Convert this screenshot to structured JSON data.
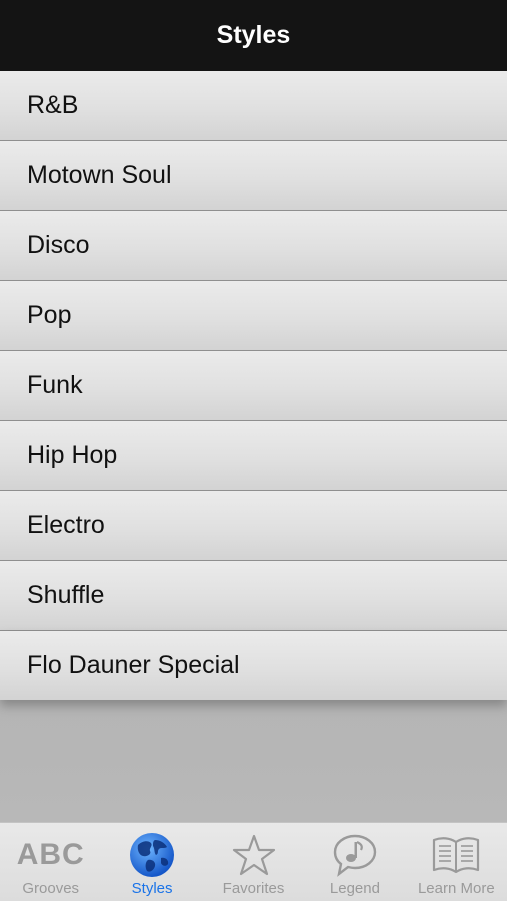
{
  "header": {
    "title": "Styles"
  },
  "styles": [
    "R&B",
    "Motown Soul",
    "Disco",
    "Pop",
    "Funk",
    "Hip Hop",
    "Electro",
    "Shuffle",
    "Flo Dauner Special"
  ],
  "tabs": [
    {
      "label": "Grooves",
      "icon": "abc-icon",
      "glyph": "ABC",
      "active": false
    },
    {
      "label": "Styles",
      "icon": "globe-icon",
      "active": true
    },
    {
      "label": "Favorites",
      "icon": "star-icon",
      "active": false
    },
    {
      "label": "Legend",
      "icon": "note-bubble-icon",
      "active": false
    },
    {
      "label": "Learn More",
      "icon": "book-icon",
      "active": false
    }
  ],
  "colors": {
    "accent": "#1a73e8",
    "navbar": "#141414",
    "inactive": "#9a9a9a"
  }
}
